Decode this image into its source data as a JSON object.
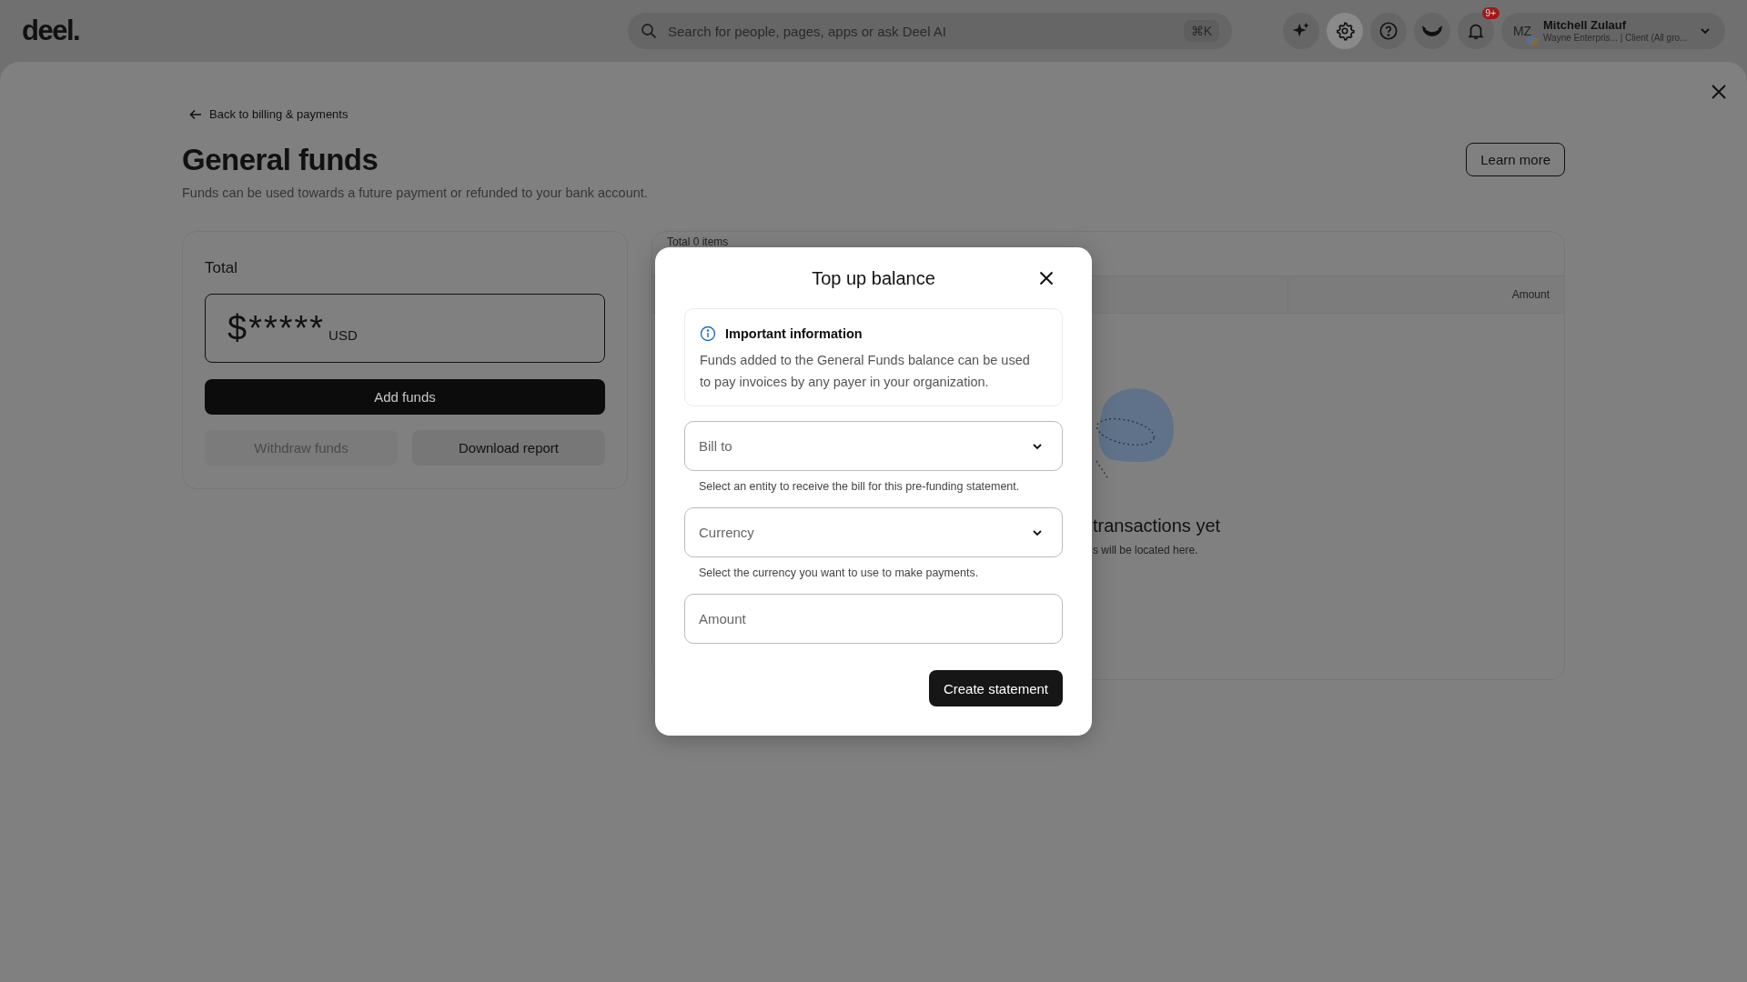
{
  "topbar": {
    "logo": "deel.",
    "search": {
      "placeholder": "Search for people, pages, apps or ask Deel AI",
      "shortcut": "⌘K"
    },
    "icons": [
      {
        "kind": "sparkle",
        "selected": false
      },
      {
        "kind": "settings",
        "selected": true
      },
      {
        "kind": "help",
        "selected": false
      },
      {
        "kind": "eye",
        "selected": false
      },
      {
        "kind": "bell",
        "selected": false,
        "badge": "9+"
      }
    ],
    "user": {
      "initials": "MZ",
      "name": "Mitchell Zulauf",
      "subtitle": "Wayne Enterpris... | Client (All gro..."
    }
  },
  "page": {
    "back_link": "Back to billing & payments",
    "title": "General funds",
    "subtitle": "Funds can be used towards a future payment or refunded to your bank account.",
    "learn_more": "Learn more",
    "total_card": {
      "label": "Total",
      "amount": "$*****",
      "currency": "USD",
      "buttons": [
        {
          "label": "Add funds",
          "kind": "primary",
          "disabled": false
        },
        {
          "label": "Withdraw funds",
          "kind": "secondary",
          "disabled": true
        },
        {
          "label": "Download report",
          "kind": "secondary",
          "disabled": false
        }
      ]
    },
    "transactions": {
      "count": "Total 0 items",
      "columns": [
        "Amount"
      ],
      "empty_title": "transactions yet",
      "empty_text": "s will be located here."
    }
  },
  "modal": {
    "title": "Top up balance",
    "info": {
      "title": "Important information",
      "text": "Funds added to the General Funds balance can be used to pay invoices by any payer in your organization."
    },
    "fields": [
      {
        "kind": "select",
        "placeholder": "Bill to",
        "helper": "Select an entity to receive the bill for this pre-funding statement."
      },
      {
        "kind": "select",
        "placeholder": "Currency",
        "helper": "Select the currency you want to use to make payments."
      },
      {
        "kind": "input",
        "placeholder": "Amount"
      }
    ],
    "submit": "Create statement"
  }
}
